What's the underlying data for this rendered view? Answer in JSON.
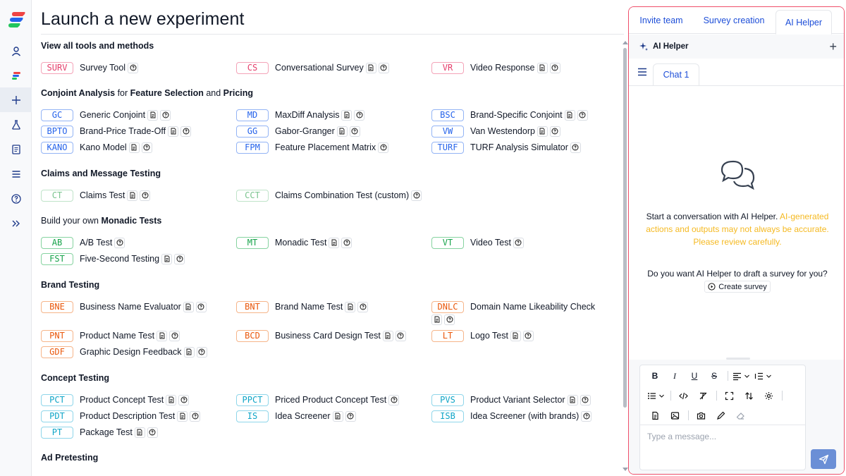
{
  "app": {
    "brand_colors": {
      "red": "#ef4444",
      "blue": "#2563eb",
      "green": "#22c55e"
    },
    "rail_icons": [
      "person-icon",
      "logo-small-icon",
      "plus-icon",
      "flask-icon",
      "document-icon",
      "list-icon",
      "help-icon",
      "expand-icon"
    ]
  },
  "main": {
    "title": "Launch a new experiment",
    "sections": {
      "all_tools": "View all tools and methods",
      "conjoint": {
        "part1": "Conjoint Analysis",
        "part2": " for ",
        "part3": "Feature Selection",
        "part4": " and ",
        "part5": "Pricing"
      },
      "claims": "Claims and Message Testing",
      "monadic": {
        "part1": "Build your own ",
        "part2": "Monadic Tests"
      },
      "brand": "Brand Testing",
      "concept": "Concept Testing",
      "ad": "Ad Pretesting"
    },
    "tools": {
      "surv": {
        "code": "SURV",
        "name": "Survey Tool"
      },
      "cs": {
        "code": "CS",
        "name": "Conversational Survey"
      },
      "vr": {
        "code": "VR",
        "name": "Video Response"
      },
      "gc": {
        "code": "GC",
        "name": "Generic Conjoint"
      },
      "md": {
        "code": "MD",
        "name": "MaxDiff Analysis"
      },
      "bsc": {
        "code": "BSC",
        "name": "Brand-Specific Conjoint"
      },
      "bpto": {
        "code": "BPTO",
        "name": "Brand-Price Trade-Off"
      },
      "gg": {
        "code": "GG",
        "name": "Gabor-Granger"
      },
      "vw": {
        "code": "VW",
        "name": "Van Westendorp"
      },
      "kano": {
        "code": "KANO",
        "name": "Kano Model"
      },
      "fpm": {
        "code": "FPM",
        "name": "Feature Placement Matrix"
      },
      "turf": {
        "code": "TURF",
        "name": "TURF Analysis Simulator"
      },
      "ct": {
        "code": "CT",
        "name": "Claims Test"
      },
      "cct": {
        "code": "CCT",
        "name": "Claims Combination Test (custom)"
      },
      "ab": {
        "code": "AB",
        "name": "A/B Test"
      },
      "mt": {
        "code": "MT",
        "name": "Monadic Test"
      },
      "vt": {
        "code": "VT",
        "name": "Video Test"
      },
      "fst": {
        "code": "FST",
        "name": "Five-Second Testing"
      },
      "bne": {
        "code": "BNE",
        "name": "Business Name Evaluator"
      },
      "bnt": {
        "code": "BNT",
        "name": "Brand Name Test"
      },
      "dnlc": {
        "code": "DNLC",
        "name": "Domain Name Likeability Check"
      },
      "pnt": {
        "code": "PNT",
        "name": "Product Name Test"
      },
      "bcd": {
        "code": "BCD",
        "name": "Business Card Design Test"
      },
      "lt": {
        "code": "LT",
        "name": "Logo Test"
      },
      "gdf": {
        "code": "GDF",
        "name": "Graphic Design Feedback"
      },
      "pct": {
        "code": "PCT",
        "name": "Product Concept Test"
      },
      "ppct": {
        "code": "PPCT",
        "name": "Priced Product Concept Test"
      },
      "pvs": {
        "code": "PVS",
        "name": "Product Variant Selector"
      },
      "pdt": {
        "code": "PDT",
        "name": "Product Description Test"
      },
      "is": {
        "code": "IS",
        "name": "Idea Screener"
      },
      "isb": {
        "code": "ISB",
        "name": "Idea Screener (with brands)"
      },
      "pt": {
        "code": "PT",
        "name": "Package Test"
      }
    }
  },
  "panel": {
    "tabs": [
      "Invite team",
      "Survey creation",
      "AI Helper"
    ],
    "active_tab": "AI Helper",
    "header_title": "AI Helper",
    "chat_tab": "Chat 1",
    "intro": "Start a conversation with AI Helper.",
    "warning": "AI-generated actions and outputs may not always be accurate. Please review carefully.",
    "question": "Do you want AI Helper to draft a survey for you?",
    "create_button": "Create survey",
    "input_placeholder": "Type a message...",
    "accent_border": "#ef4f6a",
    "send_color": "#6b8fd6"
  }
}
